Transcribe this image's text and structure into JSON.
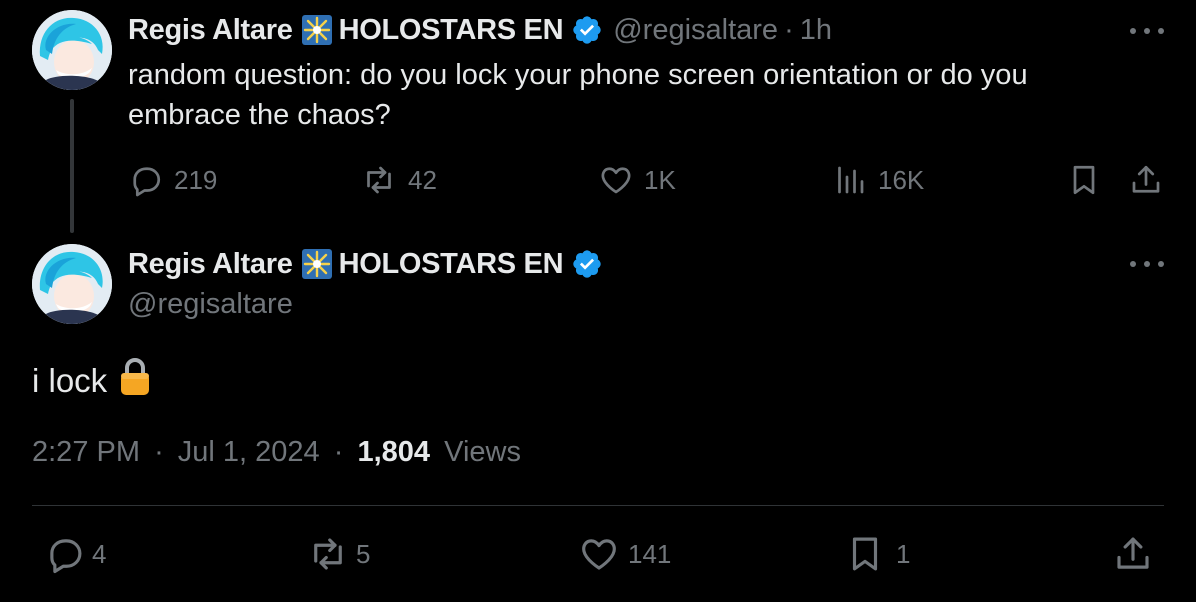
{
  "parent_tweet": {
    "display_name": "Regis Altare",
    "affiliation": "HOLOSTARS EN",
    "handle": "@regisaltare",
    "time": "1h",
    "separator": "·",
    "text_line1": "random question: do you lock your phone screen orientation or do you",
    "text_line2": "embrace the chaos?",
    "actions": {
      "replies": "219",
      "reposts": "42",
      "likes": "1K",
      "views": "16K"
    }
  },
  "reply_tweet": {
    "display_name": "Regis Altare",
    "affiliation": "HOLOSTARS EN",
    "handle": "@regisaltare",
    "text": "i lock",
    "time": "2:27 PM",
    "date": "Jul 1, 2024",
    "separator": "·",
    "view_count": "1,804",
    "views_label": "Views",
    "actions": {
      "replies": "4",
      "reposts": "5",
      "likes": "141",
      "bookmarks": "1"
    }
  },
  "colors": {
    "background": "#000000",
    "text_primary": "#e7e9ea",
    "text_secondary": "#71767b",
    "verified_blue": "#1d9bf0",
    "divider": "#2f3336",
    "lock_emoji": "#f5a623"
  },
  "icons": {
    "reply": "speech-bubble-icon",
    "repost": "repost-arrows-icon",
    "like": "heart-icon",
    "views": "bar-chart-icon",
    "bookmark": "bookmark-icon",
    "share": "share-upload-icon",
    "more": "ellipsis-icon",
    "verified": "verified-badge-icon",
    "affiliation": "holostars-badge-icon",
    "lock": "lock-emoji"
  }
}
